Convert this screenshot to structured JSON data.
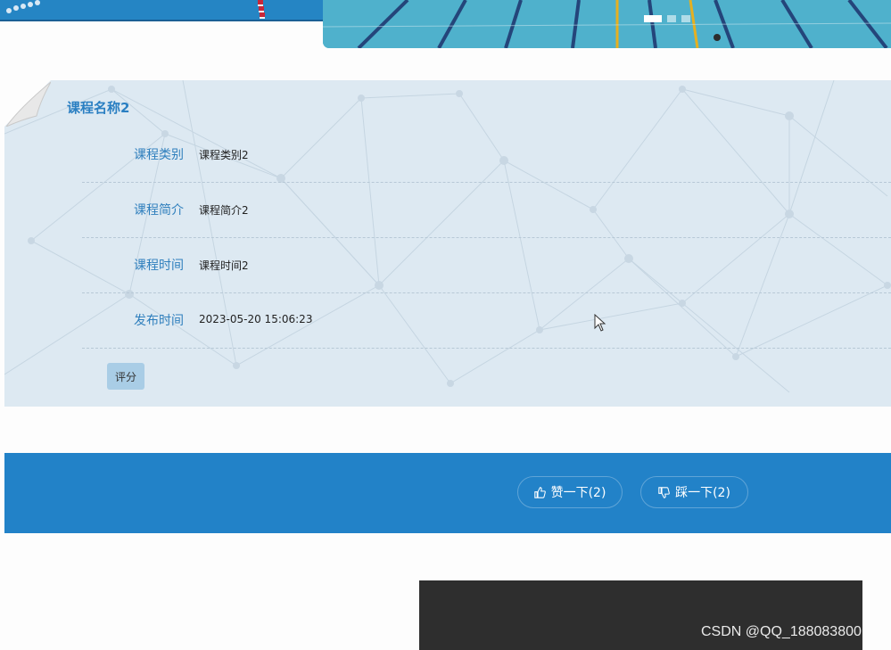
{
  "carousel": {
    "slides": 3,
    "active_slide": 1
  },
  "course": {
    "title": "课程名称2",
    "fields": [
      {
        "label": "课程类别",
        "value": "课程类别2"
      },
      {
        "label": "课程简介",
        "value": "课程简介2"
      },
      {
        "label": "课程时间",
        "value": "课程时间2"
      },
      {
        "label": "发布时间",
        "value": "2023-05-20 15:06:23"
      }
    ],
    "rate_label": "评分"
  },
  "votes": {
    "like_label": "赞一下(2)",
    "dislike_label": "踩一下(2)"
  },
  "watermark": "CSDN @QQ_188083800",
  "colors": {
    "accent": "#2282c8",
    "label_blue": "#2f7fbd",
    "card_bg": "#dde9f2"
  }
}
